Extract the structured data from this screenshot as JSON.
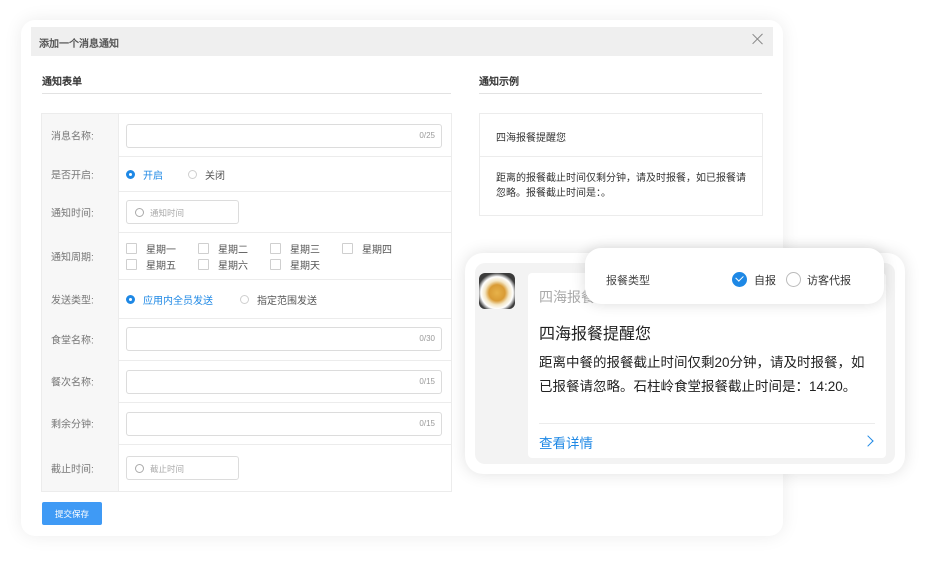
{
  "dialog": {
    "title": "添加一个消息通知",
    "form_section_title": "通知表单",
    "example_section_title": "通知示例",
    "submit_label": "提交保存"
  },
  "form": {
    "name": {
      "label": "消息名称:",
      "value": "",
      "counter": "0/25"
    },
    "enabled": {
      "label": "是否开启:",
      "options": [
        "开启",
        "关闭"
      ],
      "selected": "开启"
    },
    "time": {
      "label": "通知时间:",
      "placeholder": "通知时间"
    },
    "period": {
      "label": "通知周期:",
      "days": [
        "星期一",
        "星期二",
        "星期三",
        "星期四",
        "星期五",
        "星期六",
        "星期天"
      ]
    },
    "send_type": {
      "label": "发送类型:",
      "options": [
        "应用内全员发送",
        "指定范围发送"
      ],
      "selected": "应用内全员发送"
    },
    "canteen": {
      "label": "食堂名称:",
      "value": "",
      "counter": "0/30"
    },
    "meal": {
      "label": "餐次名称:",
      "value": "",
      "counter": "0/15"
    },
    "remaining": {
      "label": "剩余分钟:",
      "value": "",
      "counter": "0/15"
    },
    "deadline": {
      "label": "截止时间:",
      "placeholder": "截止时间"
    }
  },
  "example": {
    "title": "四海报餐提醒您",
    "body": "距离的报餐截止时间仅剩分钟，请及时报餐，如已报餐请忽略。报餐截止时间是：。"
  },
  "preview": {
    "sender": "四海报餐",
    "title": "四海报餐提醒您",
    "body": "距离中餐的报餐截止时间仅剩20分钟，请及时报餐，如已报餐请忽略。石柱岭食堂报餐截止时间是：14:20。",
    "link": "查看详情",
    "accent_color": "#1e88e5"
  },
  "popup": {
    "label": "报餐类型",
    "options": [
      "自报",
      "访客代报"
    ],
    "selected": "自报"
  }
}
